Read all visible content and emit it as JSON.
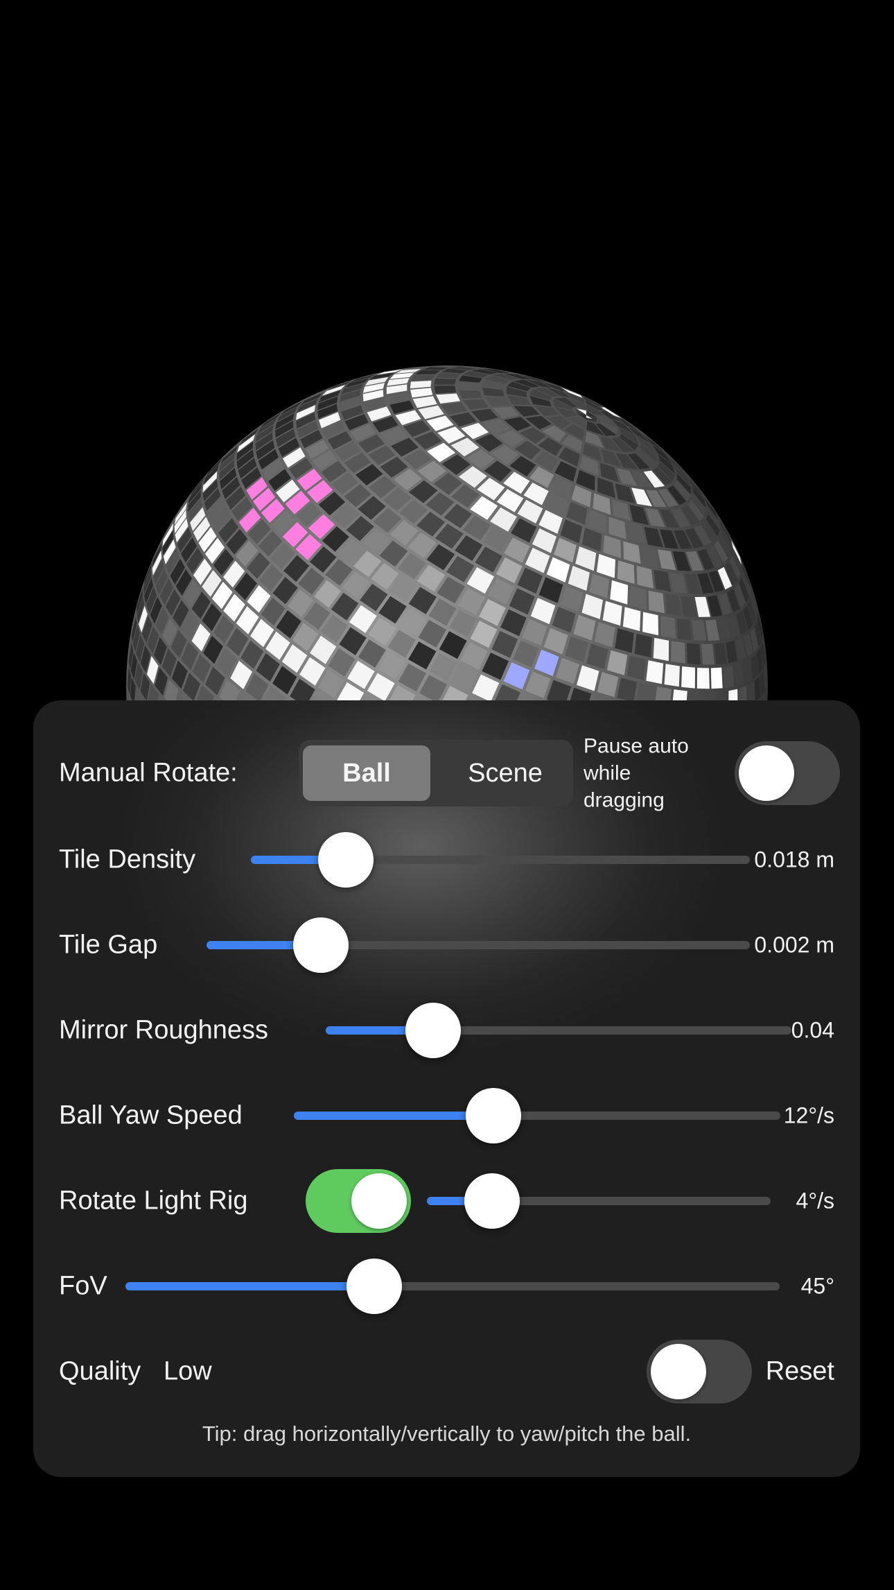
{
  "controls": {
    "manual_rotate": {
      "label": "Manual Rotate:",
      "options": [
        "Ball",
        "Scene"
      ],
      "selected": "Ball"
    },
    "pause_auto": {
      "label_lines": [
        "Pause auto",
        "while",
        "dragging"
      ],
      "enabled": false
    },
    "sliders": [
      {
        "id": "tile-density",
        "label": "Tile Density",
        "value_text": "0.018 m",
        "fraction": 0.19
      },
      {
        "id": "tile-gap",
        "label": "Tile Gap",
        "value_text": "0.002 m",
        "fraction": 0.21
      },
      {
        "id": "mirror-roughness",
        "label": "Mirror Roughness",
        "value_text": "0.04",
        "fraction": 0.23
      },
      {
        "id": "ball-yaw-speed",
        "label": "Ball Yaw Speed",
        "value_text": "12°/s",
        "fraction": 0.41
      },
      {
        "id": "light-rig-speed",
        "label": "Rotate Light Rig",
        "value_text": "4°/s",
        "fraction": 0.19
      },
      {
        "id": "fov",
        "label": "FoV",
        "value_text": "45°",
        "fraction": 0.38
      }
    ],
    "rotate_light_rig": {
      "enabled": true
    },
    "quality": {
      "label": "Quality",
      "value": "Low",
      "toggle_on": false
    },
    "reset_label": "Reset",
    "tip": "Tip: drag horizontally/vertically to yaw/pitch the ball."
  },
  "colors": {
    "background": "#000000",
    "panel": "#262626",
    "accent": "#3d82f0",
    "toggle_on": "#5fcb5f"
  },
  "scene": {
    "object": "mirror disco ball",
    "highlight_colors": [
      "#ff7fe0",
      "#9fa8ff"
    ]
  }
}
